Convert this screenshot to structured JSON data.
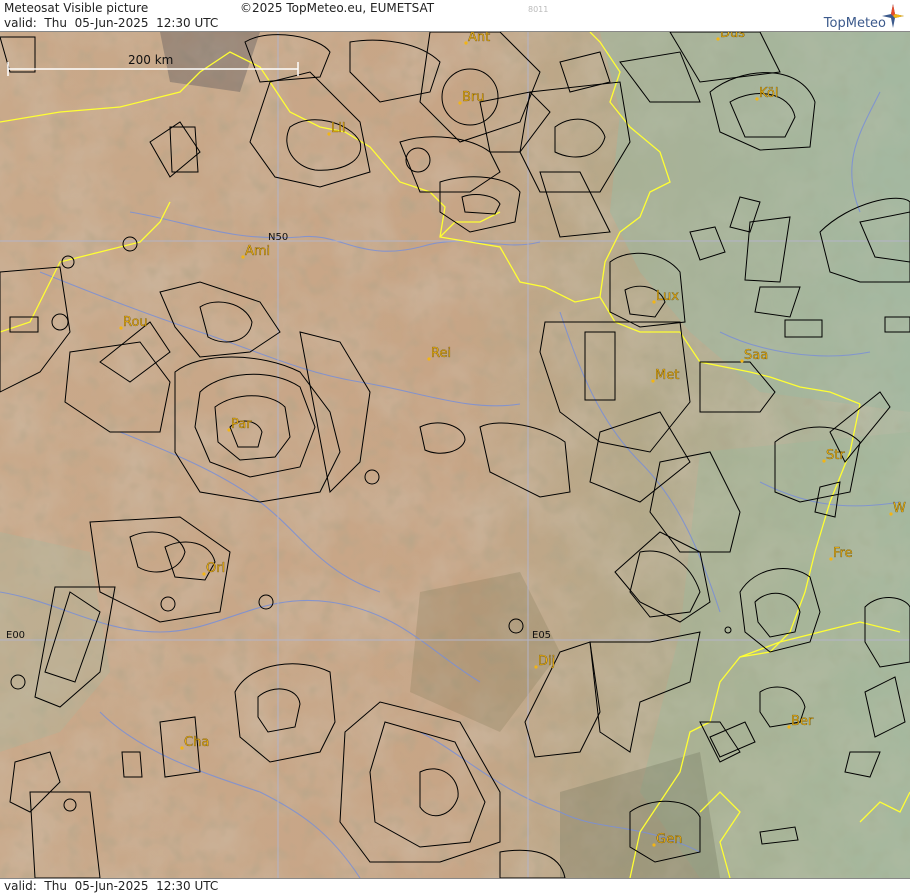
{
  "header": {
    "title": "Meteosat Visible picture",
    "valid_line": "valid:  Thu  05-Jun-2025  12:30 UTC",
    "copyright": "©2025 TopMeteo.eu, EUMETSAT",
    "code": "8011",
    "brand": "TopMeteo"
  },
  "footer": {
    "valid_line": "valid:  Thu  05-Jun-2025  12:30 UTC"
  },
  "scale": {
    "label": "200 km"
  },
  "grid_labels": {
    "lat": "N50",
    "lon0": "E00",
    "lon5": "E05"
  },
  "cities": [
    "Ant",
    "Düs",
    "Bru",
    "Köl",
    "Lil",
    "Ami",
    "Lux",
    "Rou",
    "Rei",
    "Saa",
    "Met",
    "Par",
    "Str",
    "Orl",
    "Fre",
    "Dij",
    "Ber",
    "Cha",
    "Gen",
    "W"
  ],
  "colors": {
    "city_label": "#f2b515",
    "border": "#ffff33",
    "river": "#7a8fd6",
    "airspace": "#000000",
    "grid": "#b4b4c8"
  }
}
